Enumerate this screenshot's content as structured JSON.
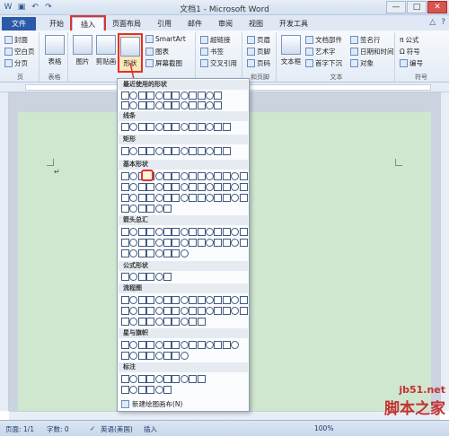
{
  "window": {
    "title": "文档1 - Microsoft Word",
    "controls": [
      "—",
      "□",
      "✕"
    ]
  },
  "tabs": [
    {
      "label": "文件"
    },
    {
      "label": "开始"
    },
    {
      "label": "插入"
    },
    {
      "label": "页面布局"
    },
    {
      "label": "引用"
    },
    {
      "label": "邮件"
    },
    {
      "label": "审阅"
    },
    {
      "label": "视图"
    },
    {
      "label": "开发工具"
    }
  ],
  "ribbon": {
    "pages": {
      "cover": "封面",
      "blank": "空白页",
      "break": "分页",
      "label": "页"
    },
    "tables": {
      "table": "表格",
      "label": "表格"
    },
    "illustrations": {
      "picture": "图片",
      "clipart": "剪贴画",
      "shapes": "形状",
      "smartart": "SmartArt",
      "chart": "图表",
      "screenshot": "屏幕截图"
    },
    "links": {
      "hyperlink": "超链接",
      "bookmark": "书签",
      "crossref": "交叉引用"
    },
    "header": {
      "header": "页眉",
      "footer": "页脚",
      "pagenum": "页码",
      "label": "和页脚"
    },
    "text": {
      "textbox": "文本框",
      "docparts": "文档部件",
      "wordart": "艺术字",
      "dropcap": "首字下沉",
      "sigline": "签名行",
      "datetime": "日期和时间",
      "object": "对象",
      "label": "文本"
    },
    "symbols": {
      "equation": "公式",
      "symbol": "符号",
      "number": "编号",
      "label": "符号"
    }
  },
  "dropdown": {
    "sections": [
      {
        "title": "最近使用的形状"
      },
      {
        "title": "线条"
      },
      {
        "title": "矩形"
      },
      {
        "title": "基本形状"
      },
      {
        "title": "箭头总汇"
      },
      {
        "title": "公式形状"
      },
      {
        "title": "流程图"
      },
      {
        "title": "星与旗帜"
      },
      {
        "title": "标注"
      }
    ],
    "new_canvas": "新建绘图画布(N)"
  },
  "statusbar": {
    "page": "页面: 1/1",
    "words": "字数: 0",
    "language": "英语(美国)",
    "mode": "插入",
    "zoom": "100%"
  },
  "watermark": {
    "line1": "jb51.net",
    "line2": "脚本之家"
  },
  "colors": {
    "accent_red": "#e03131",
    "page_green": "#cfe6cf",
    "ribbon_blue": "#2a5aa8"
  }
}
